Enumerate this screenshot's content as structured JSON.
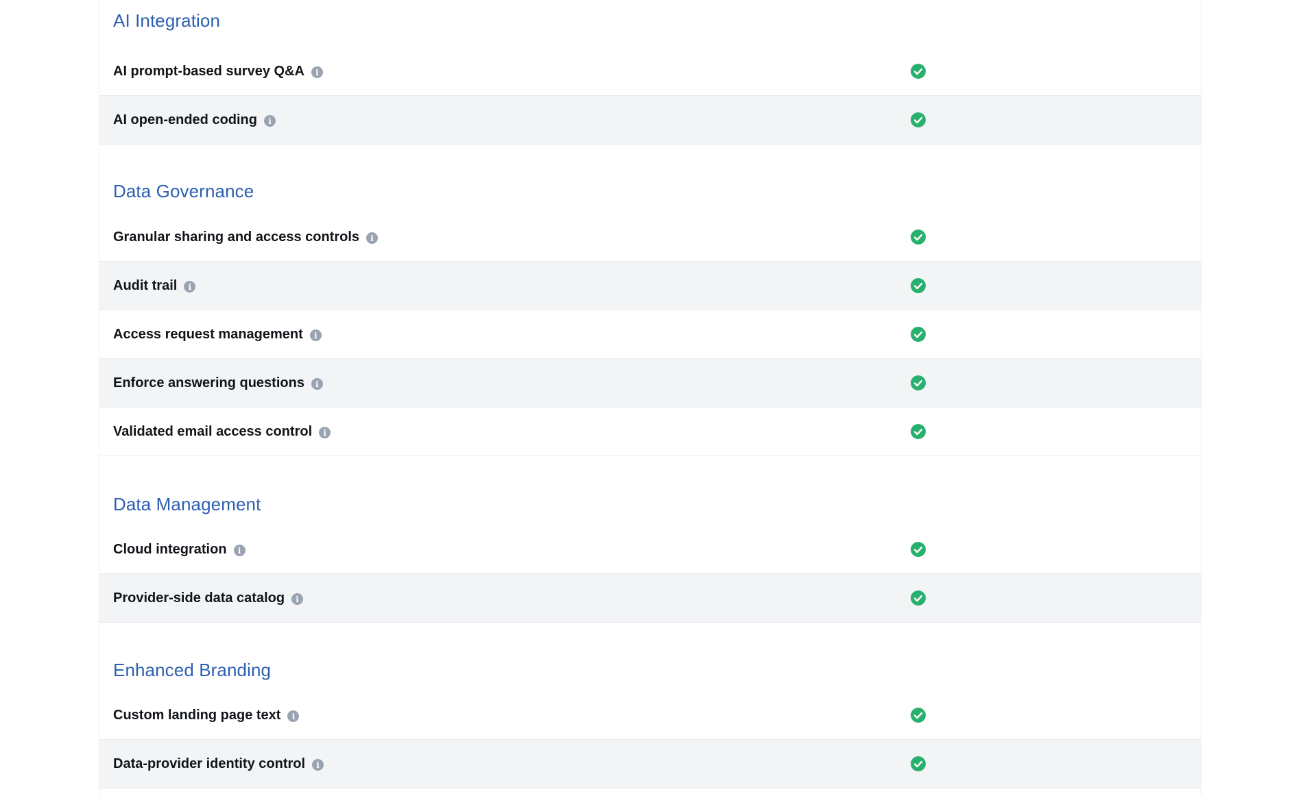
{
  "colors": {
    "section_title": "#2d5fb0",
    "check": "#27b06e",
    "info_icon": "#9aa3b2",
    "alt_row": "#f3f4f6"
  },
  "sections": [
    {
      "title": "AI Integration",
      "rows": [
        {
          "label": "AI prompt-based survey Q&A",
          "included": true
        },
        {
          "label": "AI open-ended coding",
          "included": true
        }
      ]
    },
    {
      "title": "Data Governance",
      "rows": [
        {
          "label": "Granular sharing and access controls",
          "included": true
        },
        {
          "label": "Audit trail",
          "included": true
        },
        {
          "label": "Access request management",
          "included": true
        },
        {
          "label": "Enforce answering questions",
          "included": true
        },
        {
          "label": "Validated email access control",
          "included": true
        }
      ]
    },
    {
      "title": "Data Management",
      "rows": [
        {
          "label": "Cloud integration",
          "included": true
        },
        {
          "label": "Provider-side data catalog",
          "included": true
        }
      ]
    },
    {
      "title": "Enhanced Branding",
      "rows": [
        {
          "label": "Custom landing page text",
          "included": true
        },
        {
          "label": "Data-provider identity control",
          "included": true
        }
      ]
    }
  ],
  "icons": {
    "info": "info-icon",
    "check": "check-circle-icon"
  }
}
